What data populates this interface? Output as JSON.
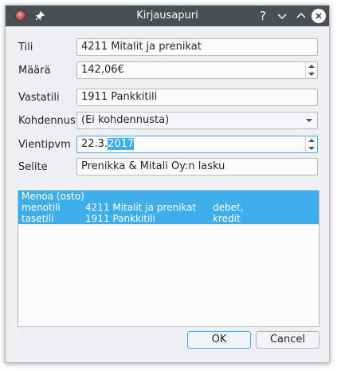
{
  "window": {
    "title": "Kirjausapuri",
    "help_glyph": "?"
  },
  "form": {
    "tili": {
      "label": "Tili",
      "value": "4211 Mitalit ja prenikat"
    },
    "maara": {
      "label": "Määrä",
      "value": "142,06€"
    },
    "vastatili": {
      "label": "Vastatili",
      "value": "1911 Pankkitili"
    },
    "kohdennus": {
      "label": "Kohdennus",
      "value": "(Ei kohdennusta)"
    },
    "vientipvm": {
      "label": "Vientipvm",
      "value_plain": "22.3.",
      "value_selected": "2017"
    },
    "selite": {
      "label": "Selite",
      "value": "Prenikka & Mitali Oy:n lasku"
    }
  },
  "entries": {
    "header": "Menoa (osto)",
    "rows": [
      {
        "role": "menotili",
        "account": "4211 Mitalit ja prenikat",
        "side": "debet,"
      },
      {
        "role": "tasetili",
        "account": "1911 Pankkitili",
        "side": "kredit"
      }
    ]
  },
  "buttons": {
    "ok": "OK",
    "cancel": "Cancel"
  },
  "colors": {
    "titlebar": "#475057",
    "selection": "#3daee9",
    "window_bg": "#eff0f1"
  }
}
